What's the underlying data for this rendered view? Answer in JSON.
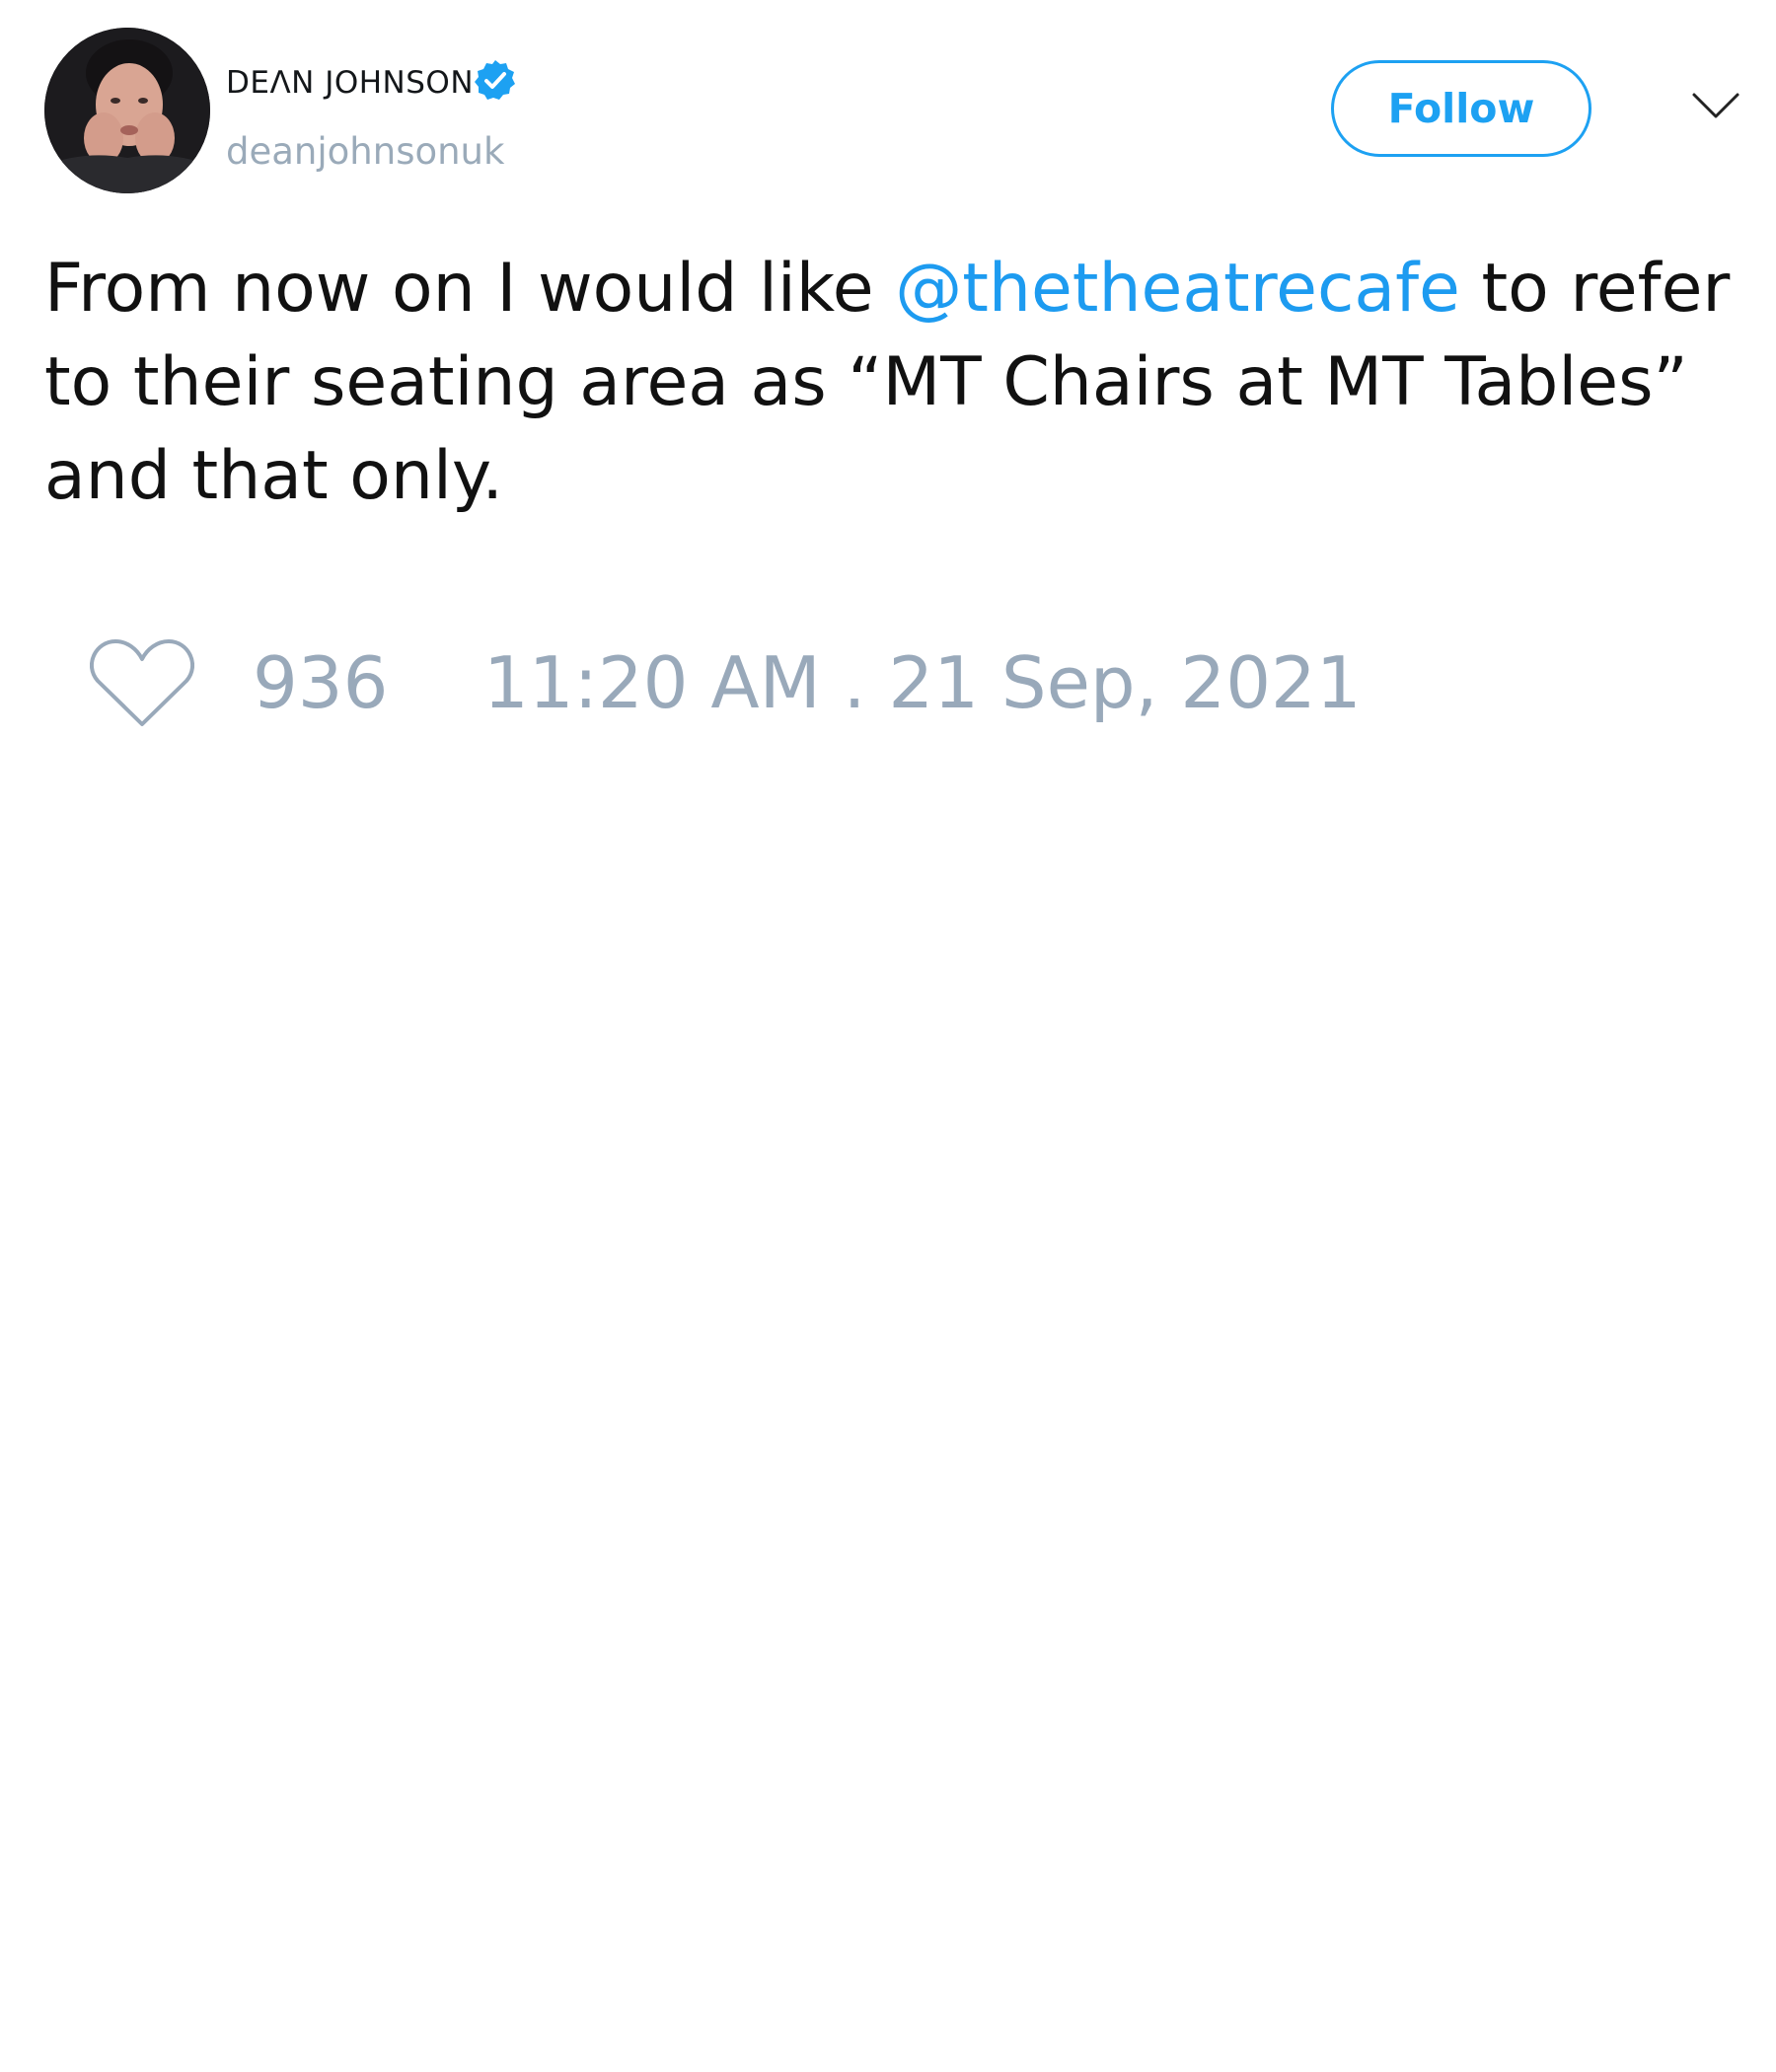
{
  "author": {
    "display_name": "DEΛN JOHNSON",
    "handle": "deanjohnsonuk",
    "verified": true,
    "avatar_icon": "profile-photo"
  },
  "actions": {
    "follow_label": "Follow",
    "menu_icon": "chevron-down-icon"
  },
  "tweet": {
    "text_parts": {
      "line1_before": "From now on I would like ",
      "mention": "@thetheatrecafe",
      "line1_after": " to refer",
      "line2": "to their seating area as “MT Chairs at MT Tables”",
      "line3": "and that only."
    },
    "likes": "936",
    "timestamp": "11:20 AM . 21 Sep, 2021"
  },
  "colors": {
    "accent": "#1da1f2",
    "muted": "#99a9ba",
    "text": "#111111"
  }
}
